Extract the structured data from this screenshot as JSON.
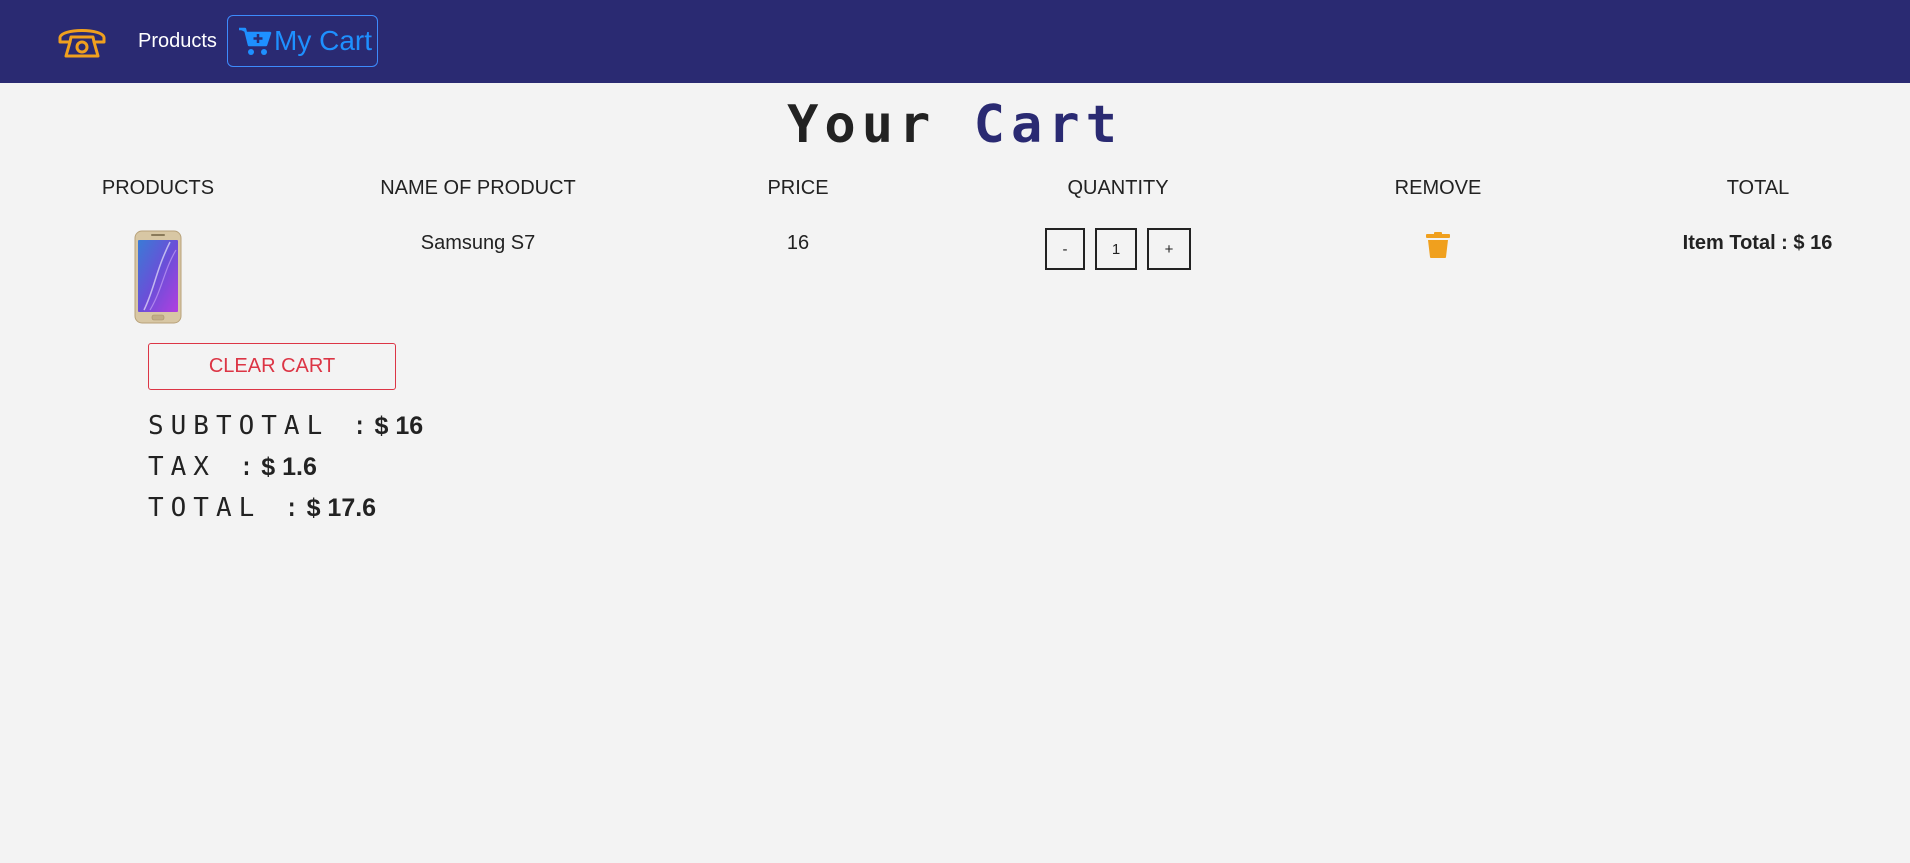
{
  "navbar": {
    "logo_icon": "phone-icon",
    "products_label": "Products",
    "cart_label": "My Cart",
    "cart_icon": "cart-plus-icon",
    "background_color": "#2a2a72",
    "cart_color": "#1e90ff"
  },
  "title": {
    "part1": "Your",
    "part2": "Cart"
  },
  "columns": [
    "PRODUCTS",
    "NAME OF PRODUCT",
    "PRICE",
    "QUANTITY",
    "REMOVE",
    "TOTAL"
  ],
  "items": [
    {
      "image_icon": "samsung-phone-image",
      "name": "Samsung S7",
      "price": "16",
      "decrement_label": "-",
      "quantity": "1",
      "increment_label": "+",
      "remove_icon": "trash-icon",
      "item_total_label": "Item Total : $ 16"
    }
  ],
  "clear_cart_label": "CLEAR CART",
  "summary": {
    "subtotal_label": "SUBTOTAL :",
    "subtotal_value": "$ 16",
    "tax_label": "TAX :",
    "tax_value": "$ 1.6",
    "total_label": "TOTAL :",
    "total_value": "$ 17.6"
  },
  "colors": {
    "accent": "#2a2a72",
    "danger": "#dc3545",
    "trash": "#f0a01e"
  }
}
